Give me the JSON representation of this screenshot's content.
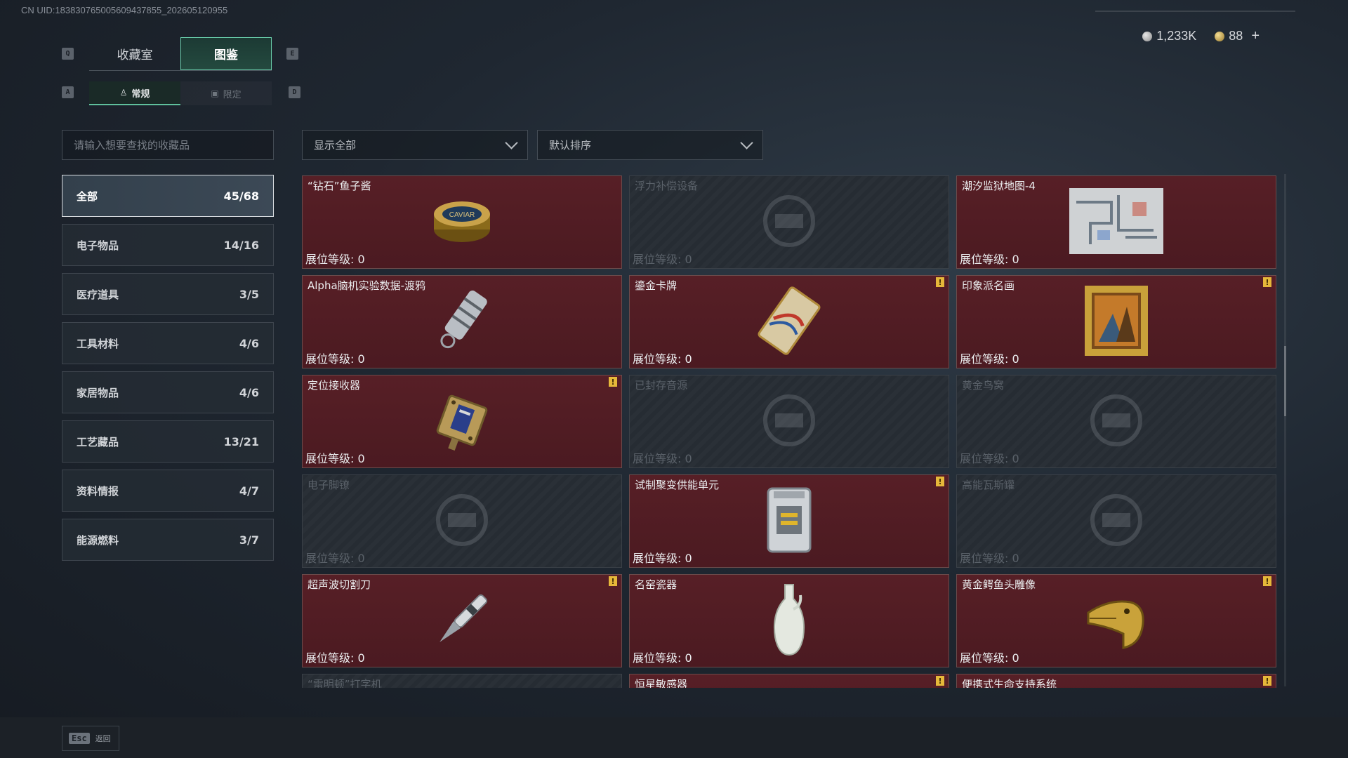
{
  "uid_text": "CN UID:183830765005609437855_202605120955",
  "currency": {
    "silver": "1,233K",
    "gold": "88",
    "plus": "+"
  },
  "keys": {
    "prev_tab": "Q",
    "next_tab": "E",
    "prev_sub": "A",
    "next_sub": "D"
  },
  "tabs": [
    {
      "label": "收藏室",
      "active": false
    },
    {
      "label": "图鉴",
      "active": true
    }
  ],
  "subtabs": [
    {
      "label": "常规",
      "active": true
    },
    {
      "label": "限定",
      "active": false
    }
  ],
  "search": {
    "placeholder": "请输入想要查找的收藏品"
  },
  "filters": {
    "show": "显示全部",
    "sort": "默认排序"
  },
  "categories": [
    {
      "label": "全部",
      "count": "45/68",
      "active": true
    },
    {
      "label": "电子物品",
      "count": "14/16"
    },
    {
      "label": "医疗道具",
      "count": "3/5"
    },
    {
      "label": "工具材料",
      "count": "4/6"
    },
    {
      "label": "家居物品",
      "count": "4/6"
    },
    {
      "label": "工艺藏品",
      "count": "13/21"
    },
    {
      "label": "资料情报",
      "count": "4/7"
    },
    {
      "label": "能源燃料",
      "count": "3/7"
    }
  ],
  "level_label": "展位等级: 0",
  "flag_glyph": "!",
  "items": [
    {
      "title": "“钻石”鱼子酱",
      "locked": false,
      "flag": false,
      "icon": "caviar-tin-icon"
    },
    {
      "title": "浮力补偿设备",
      "locked": true,
      "flag": false,
      "icon": "buoyancy-device-icon"
    },
    {
      "title": "潮汐监狱地图-4",
      "locked": false,
      "flag": false,
      "icon": "map-icon"
    },
    {
      "title": "Alpha脑机实验数据-渡鸦",
      "locked": false,
      "flag": false,
      "icon": "data-drive-icon"
    },
    {
      "title": "鎏金卡牌",
      "locked": false,
      "flag": true,
      "icon": "gilded-card-icon"
    },
    {
      "title": "印象派名画",
      "locked": false,
      "flag": true,
      "icon": "painting-icon"
    },
    {
      "title": "定位接收器",
      "locked": false,
      "flag": true,
      "icon": "receiver-icon"
    },
    {
      "title": "已封存音源",
      "locked": true,
      "flag": false,
      "icon": "audio-source-icon"
    },
    {
      "title": "黄金鸟窝",
      "locked": true,
      "flag": false,
      "icon": "golden-nest-icon"
    },
    {
      "title": "电子脚镣",
      "locked": true,
      "flag": false,
      "icon": "ankle-monitor-icon"
    },
    {
      "title": "试制聚变供能单元",
      "locked": false,
      "flag": true,
      "icon": "fusion-unit-icon"
    },
    {
      "title": "高能瓦斯罐",
      "locked": true,
      "flag": false,
      "icon": "gas-canister-icon"
    },
    {
      "title": "超声波切割刀",
      "locked": false,
      "flag": true,
      "icon": "ultrasonic-knife-icon"
    },
    {
      "title": "名窑瓷器",
      "locked": false,
      "flag": false,
      "icon": "porcelain-vase-icon"
    },
    {
      "title": "黄金鳄鱼头雕像",
      "locked": false,
      "flag": true,
      "icon": "gold-crocodile-icon"
    },
    {
      "title": "“雷明顿”打字机",
      "locked": true,
      "flag": false,
      "icon": "typewriter-icon"
    },
    {
      "title": "恒星敏感器",
      "locked": false,
      "flag": true,
      "icon": "star-sensor-icon"
    },
    {
      "title": "便携式生命支持系统",
      "locked": false,
      "flag": true,
      "icon": "life-support-icon"
    }
  ],
  "footer": {
    "esc_key": "Esc",
    "esc_label": "返回"
  }
}
